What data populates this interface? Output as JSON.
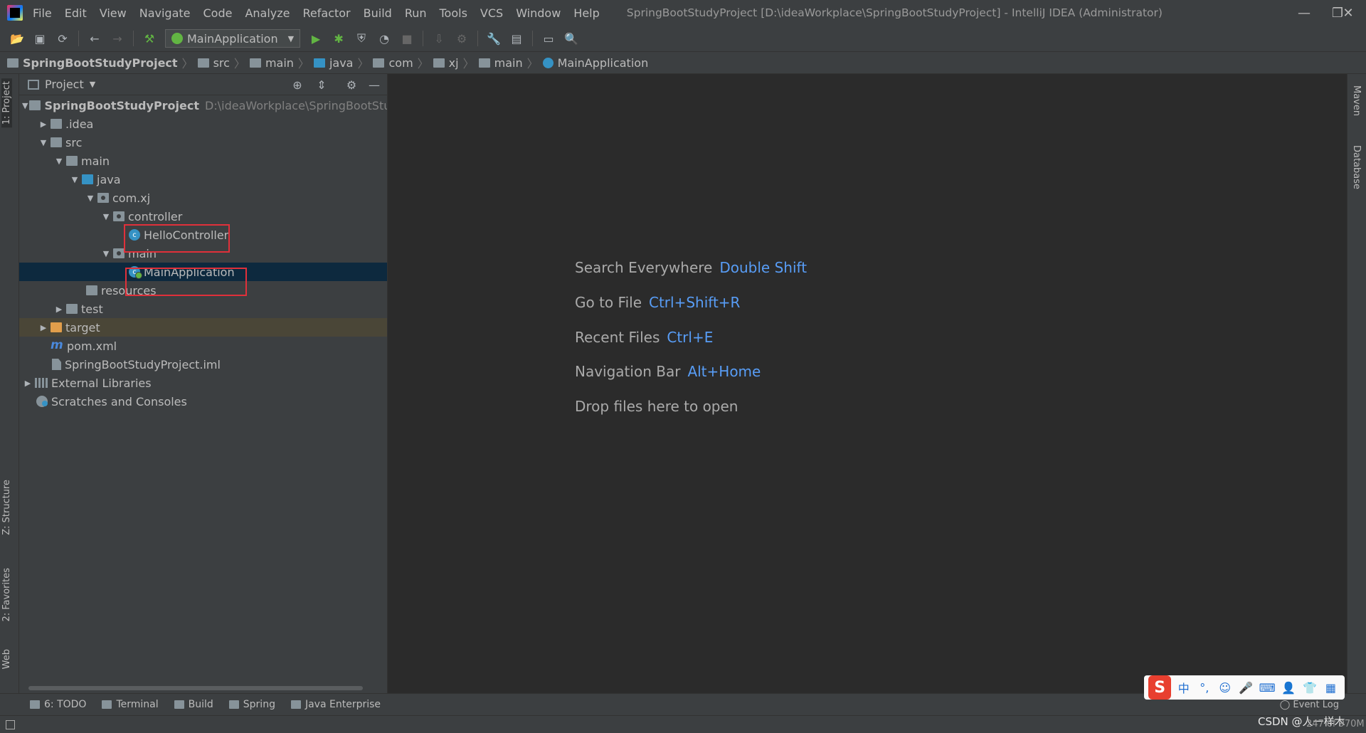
{
  "window": {
    "title": "SpringBootStudyProject [D:\\ideaWorkplace\\SpringBootStudyProject] - IntelliJ IDEA (Administrator)",
    "menu": [
      "File",
      "Edit",
      "View",
      "Navigate",
      "Code",
      "Analyze",
      "Refactor",
      "Build",
      "Run",
      "Tools",
      "VCS",
      "Window",
      "Help"
    ]
  },
  "toolbar": {
    "run_config": "MainApplication"
  },
  "breadcrumbs": [
    "SpringBootStudyProject",
    "src",
    "main",
    "java",
    "com",
    "xj",
    "main",
    "MainApplication"
  ],
  "left_tabs": {
    "project": "1: Project",
    "structure": "Z: Structure",
    "favorites": "2: Favorites",
    "web": "Web"
  },
  "right_tabs": {
    "maven": "Maven",
    "database": "Database"
  },
  "project_panel": {
    "title": "Project",
    "root_path": "D:\\ideaWorkplace\\SpringBootStudyPro",
    "tree": [
      {
        "label": "SpringBootStudyProject",
        "bold": true
      },
      {
        "label": ".idea"
      },
      {
        "label": "src"
      },
      {
        "label": "main"
      },
      {
        "label": "java"
      },
      {
        "label": "com.xj"
      },
      {
        "label": "controller"
      },
      {
        "label": "HelloController"
      },
      {
        "label": "main"
      },
      {
        "label": "MainApplication"
      },
      {
        "label": "resources"
      },
      {
        "label": "test"
      },
      {
        "label": "target"
      },
      {
        "label": "pom.xml"
      },
      {
        "label": "SpringBootStudyProject.iml"
      },
      {
        "label": "External Libraries"
      },
      {
        "label": "Scratches and Consoles"
      }
    ]
  },
  "editor_hints": [
    {
      "label": "Search Everywhere",
      "shortcut": "Double Shift"
    },
    {
      "label": "Go to File",
      "shortcut": "Ctrl+Shift+R"
    },
    {
      "label": "Recent Files",
      "shortcut": "Ctrl+E"
    },
    {
      "label": "Navigation Bar",
      "shortcut": "Alt+Home"
    },
    {
      "label": "Drop files here to open",
      "shortcut": ""
    }
  ],
  "bottom_tabs": [
    "6: TODO",
    "Terminal",
    "Build",
    "Spring",
    "Java Enterprise"
  ],
  "event_log": "Event Log",
  "ime": {
    "logo": "S",
    "items": [
      "中",
      "°,",
      "☺",
      "🎤",
      "⌨",
      "👤",
      "👕",
      "▦"
    ]
  },
  "watermark": "CSDN @人一样木",
  "memory": "247 of 970M",
  "colors": {
    "selection": "#0d293e",
    "excluded": "#4a4637",
    "shortcut": "#589df6",
    "highlight_box": "#e0303a"
  }
}
